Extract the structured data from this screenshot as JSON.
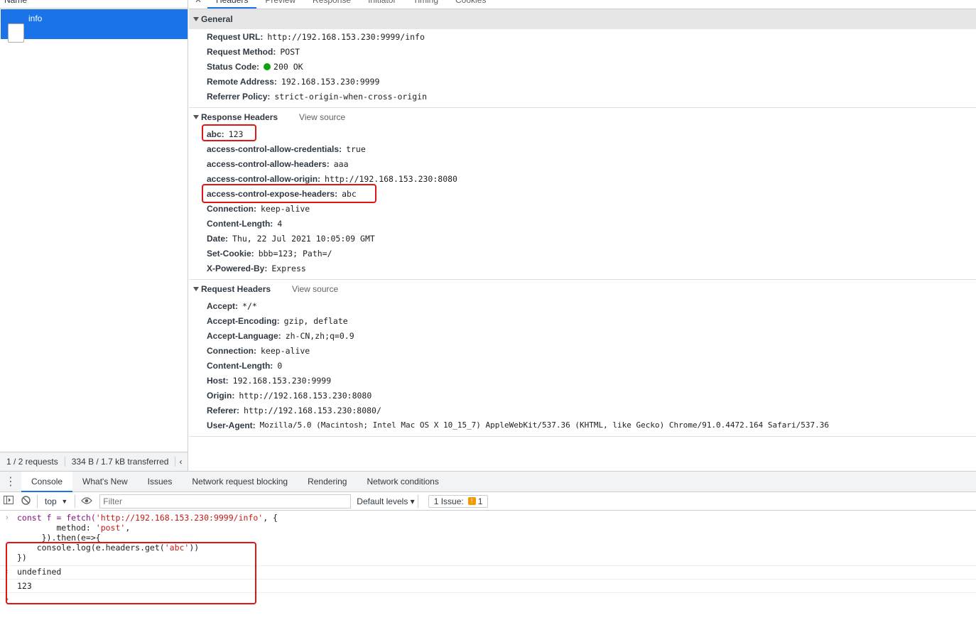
{
  "request_list": {
    "column_header": "Name",
    "selected_request": "info",
    "summary": [
      "1 / 2 requests",
      "334 B / 1.7 kB transferred",
      "‹"
    ]
  },
  "details_tabs": [
    "Headers",
    "Preview",
    "Response",
    "Initiator",
    "Timing",
    "Cookies"
  ],
  "general": {
    "title": "General",
    "rows": [
      {
        "k": "Request URL:",
        "v": "http://192.168.153.230:9999/info"
      },
      {
        "k": "Request Method:",
        "v": "POST"
      },
      {
        "k": "Status Code:",
        "v": "200 OK"
      },
      {
        "k": "Remote Address:",
        "v": "192.168.153.230:9999"
      },
      {
        "k": "Referrer Policy:",
        "v": "strict-origin-when-cross-origin"
      }
    ]
  },
  "response_headers": {
    "title": "Response Headers",
    "view_source": "View source",
    "rows": [
      {
        "k": "abc:",
        "v": "123"
      },
      {
        "k": "access-control-allow-credentials:",
        "v": "true"
      },
      {
        "k": "access-control-allow-headers:",
        "v": "aaa"
      },
      {
        "k": "access-control-allow-origin:",
        "v": "http://192.168.153.230:8080"
      },
      {
        "k": "access-control-expose-headers:",
        "v": "abc"
      },
      {
        "k": "Connection:",
        "v": "keep-alive"
      },
      {
        "k": "Content-Length:",
        "v": "4"
      },
      {
        "k": "Date:",
        "v": "Thu, 22 Jul 2021 10:05:09 GMT"
      },
      {
        "k": "Set-Cookie:",
        "v": "bbb=123; Path=/"
      },
      {
        "k": "X-Powered-By:",
        "v": "Express"
      }
    ]
  },
  "request_headers": {
    "title": "Request Headers",
    "view_source": "View source",
    "rows": [
      {
        "k": "Accept:",
        "v": "*/*"
      },
      {
        "k": "Accept-Encoding:",
        "v": "gzip, deflate"
      },
      {
        "k": "Accept-Language:",
        "v": "zh-CN,zh;q=0.9"
      },
      {
        "k": "Connection:",
        "v": "keep-alive"
      },
      {
        "k": "Content-Length:",
        "v": "0"
      },
      {
        "k": "Host:",
        "v": "192.168.153.230:9999"
      },
      {
        "k": "Origin:",
        "v": "http://192.168.153.230:8080"
      },
      {
        "k": "Referer:",
        "v": "http://192.168.153.230:8080/"
      },
      {
        "k": "User-Agent:",
        "v": "Mozilla/5.0 (Macintosh; Intel Mac OS X 10_15_7) AppleWebKit/537.36 (KHTML, like Gecko) Chrome/91.0.4472.164 Safari/537.36"
      }
    ]
  },
  "drawer": {
    "tabs": [
      "Console",
      "What's New",
      "Issues",
      "Network request blocking",
      "Rendering",
      "Network conditions"
    ],
    "context": "top",
    "filter_placeholder": "Filter",
    "levels": "Default levels ▾",
    "issues_label": "1 Issue:",
    "issues_count": "1"
  },
  "console": {
    "input": {
      "l1_pre": "const f = fetch(",
      "l1_str": "'http://192.168.153.230:9999/info'",
      "l1_post": ", {",
      "l2_pre": "        method: ",
      "l2_str": "'post'",
      "l2_post": ",",
      "l3": "     }).then(e=>{",
      "l4_pre": "    console.log(e.headers.get(",
      "l4_str": "'abc'",
      "l4_post": "))",
      "l5": "})"
    },
    "result": "undefined",
    "log": "123"
  },
  "colors": {
    "accent": "#1a73e8",
    "highlight_box": "#e01515",
    "status_ok": "#0ca40c"
  }
}
